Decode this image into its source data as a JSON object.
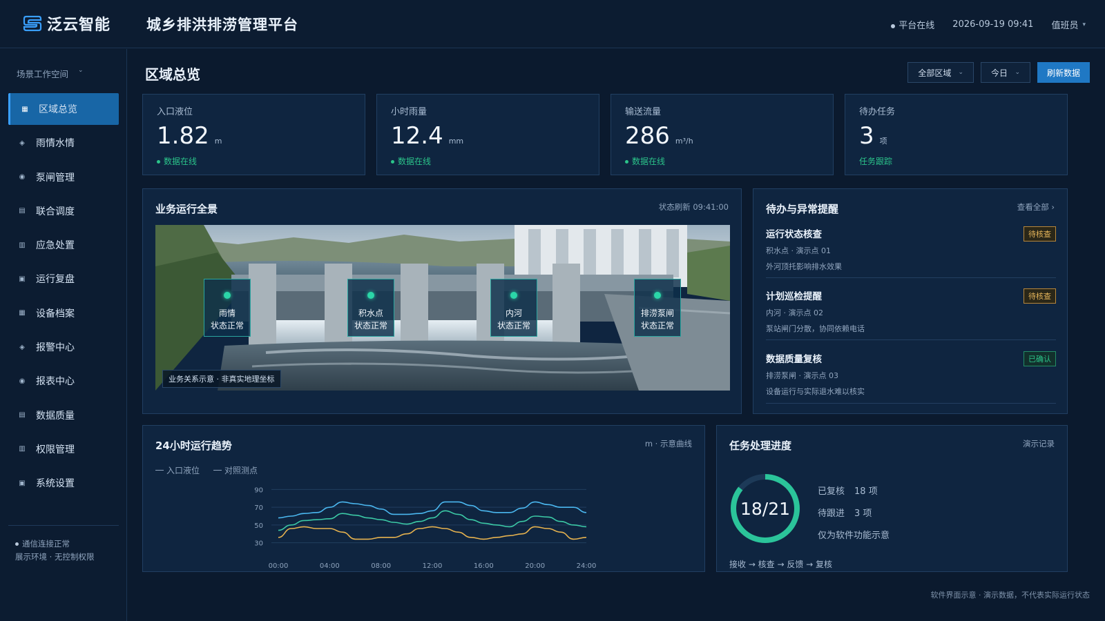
{
  "brand": {
    "name": "泛云智能",
    "app_title": "城乡排洪排涝管理平台"
  },
  "topbar": {
    "status": "平台在线",
    "datetime": "2026-09-19 09:41",
    "user": "值班员"
  },
  "sidebar": {
    "workspace": "场景工作空间",
    "items": [
      {
        "label": "区域总览",
        "icon": "grid-icon",
        "active": true
      },
      {
        "label": "雨情水情",
        "icon": "diamond-icon"
      },
      {
        "label": "泵闸管理",
        "icon": "target-icon"
      },
      {
        "label": "联合调度",
        "icon": "list-icon"
      },
      {
        "label": "应急处置",
        "icon": "columns-icon"
      },
      {
        "label": "运行复盘",
        "icon": "square-icon"
      },
      {
        "label": "设备档案",
        "icon": "grid-icon"
      },
      {
        "label": "报警中心",
        "icon": "diamond-icon"
      },
      {
        "label": "报表中心",
        "icon": "target-icon"
      },
      {
        "label": "数据质量",
        "icon": "list-icon"
      },
      {
        "label": "权限管理",
        "icon": "columns-icon"
      },
      {
        "label": "系统设置",
        "icon": "square-icon"
      }
    ],
    "footer_line1": "通信连接正常",
    "footer_line2": "展示环境 · 无控制权限"
  },
  "header": {
    "title": "区域总览",
    "region_select": "全部区域",
    "period_select": "今日",
    "refresh_label": "刷新数据"
  },
  "kpis": [
    {
      "label": "入口液位",
      "value": "1.82",
      "unit": "m",
      "status": "数据在线",
      "dot": true
    },
    {
      "label": "小时雨量",
      "value": "12.4",
      "unit": "mm",
      "status": "数据在线",
      "dot": true
    },
    {
      "label": "输送流量",
      "value": "286",
      "unit": "m³/h",
      "status": "数据在线",
      "dot": true
    },
    {
      "label": "待办任务",
      "value": "3",
      "unit": "项",
      "status": "任务跟踪",
      "dot": false
    }
  ],
  "overview": {
    "title": "业务运行全景",
    "refresh": "状态刷新 09:41:00",
    "caption": "业务关系示意 · 非真实地理坐标",
    "markers": [
      {
        "name": "雨情",
        "status": "状态正常"
      },
      {
        "name": "积水点",
        "status": "状态正常"
      },
      {
        "name": "内河",
        "status": "状态正常"
      },
      {
        "name": "排涝泵闸",
        "status": "状态正常"
      }
    ]
  },
  "alerts": {
    "title": "待办与异常提醒",
    "view_all": "查看全部 ›",
    "items": [
      {
        "title": "运行状态核查",
        "sub": "积水点 · 演示点 01",
        "desc": "外河顶托影响排水效果",
        "badge": "待核查",
        "badge_type": "warn"
      },
      {
        "title": "计划巡检提醒",
        "sub": "内河 · 演示点 02",
        "desc": "泵站闸门分散，协同依赖电话",
        "badge": "待核查",
        "badge_type": "warn"
      },
      {
        "title": "数据质量复核",
        "sub": "排涝泵闸 · 演示点 03",
        "desc": "设备运行与实际退水难以核实",
        "badge": "已确认",
        "badge_type": "ok"
      }
    ]
  },
  "trend": {
    "title": "24小时运行趋势",
    "meta": "m · 示意曲线",
    "legend": [
      "入口液位",
      "对照测点"
    ]
  },
  "chart_data": {
    "type": "line",
    "x": [
      "00:00",
      "01:00",
      "02:00",
      "03:00",
      "04:00",
      "05:00",
      "06:00",
      "07:00",
      "08:00",
      "09:00",
      "10:00",
      "11:00",
      "12:00",
      "13:00",
      "14:00",
      "15:00",
      "16:00",
      "17:00",
      "18:00",
      "19:00",
      "20:00",
      "21:00",
      "22:00",
      "23:00",
      "24:00"
    ],
    "x_ticks": [
      "00:00",
      "04:00",
      "08:00",
      "12:00",
      "16:00",
      "20:00",
      "24:00"
    ],
    "y_ticks": [
      30,
      50,
      70,
      90
    ],
    "ylim": [
      25,
      95
    ],
    "grid": true,
    "series": [
      {
        "color": "#4bb8f0",
        "values": [
          58,
          60,
          63,
          64,
          70,
          76,
          74,
          72,
          68,
          62,
          62,
          63,
          66,
          76,
          76,
          72,
          66,
          64,
          64,
          69,
          76,
          73,
          70,
          70,
          64
        ]
      },
      {
        "color": "#3ccaa6",
        "values": [
          44,
          50,
          55,
          56,
          57,
          63,
          61,
          58,
          56,
          53,
          51,
          54,
          58,
          66,
          62,
          56,
          52,
          50,
          48,
          54,
          60,
          59,
          54,
          50,
          48
        ]
      },
      {
        "color": "#e7b34f",
        "values": [
          36,
          46,
          48,
          46,
          46,
          42,
          34,
          34,
          36,
          36,
          40,
          46,
          48,
          46,
          42,
          36,
          34,
          36,
          38,
          40,
          48,
          46,
          42,
          34,
          36
        ]
      }
    ]
  },
  "progress": {
    "title": "任务处理进度",
    "meta": "演示记录",
    "done": 18,
    "total": 21,
    "label": "18/21",
    "reviewed_label": "已复核",
    "reviewed_value": "18 项",
    "pending_label": "待跟进",
    "pending_value": "3 项",
    "note": "仅为软件功能示意",
    "flow": "接收 → 核查 → 反馈 → 复核",
    "ring_color": "#2bc49a"
  },
  "footnote": "软件界面示意 · 演示数据，不代表实际运行状态"
}
